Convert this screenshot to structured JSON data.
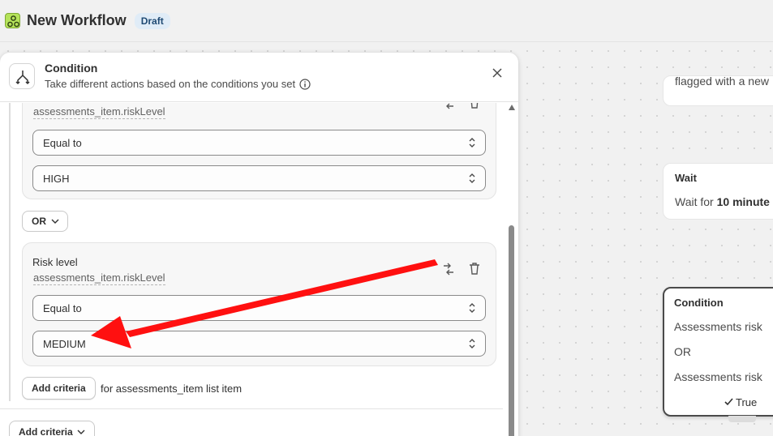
{
  "topbar": {
    "title": "New Workflow",
    "badge": "Draft",
    "icon": "workflow-app-icon"
  },
  "canvas": {
    "top_node": {
      "text": "flagged with a new"
    },
    "wait_node": {
      "title": "Wait",
      "prefix": "Wait for ",
      "bold": "10 minute"
    },
    "condition_node": {
      "title": "Condition",
      "line1": "Assessments risk",
      "line2": "OR",
      "line3": "Assessments risk",
      "true_label": "True"
    }
  },
  "panel": {
    "title": "Condition",
    "subtitle": "Take different actions based on the conditions you set",
    "criteria": [
      {
        "field": "assessments_item.riskLevel",
        "operator": "Equal to",
        "value": "HIGH"
      },
      {
        "label": "Risk level",
        "field": "assessments_item.riskLevel",
        "operator": "Equal to",
        "value": "MEDIUM"
      }
    ],
    "or_label": "OR",
    "add_criteria_inner": "Add criteria",
    "for_text": "for assessments_item list item",
    "add_criteria_outer": "Add criteria"
  },
  "colors": {
    "annotation_arrow": "#ff1010",
    "draft_badge_bg": "#e0ecf7",
    "app_icon": "#b5e35a"
  },
  "icons": [
    "condition-split-icon",
    "info-icon",
    "close-icon",
    "swap-icon",
    "trash-icon",
    "chevron-updown-icon",
    "chevron-down-icon",
    "checkmark-icon"
  ]
}
